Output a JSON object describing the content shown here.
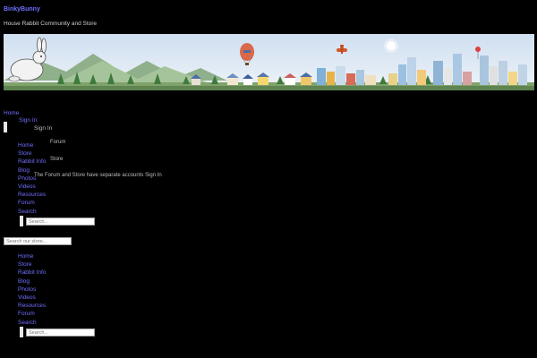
{
  "header": {
    "site_title": "BinkyBunny",
    "tagline": "House Rabbit Community and Store"
  },
  "colors": {
    "background": "#000000",
    "link": "#7070ff",
    "banner_sky": "#dde7f3"
  },
  "nav": {
    "home": "Home",
    "sign_in": "Sign In",
    "sign_in_item": "Sign In"
  },
  "menu_top": {
    "items": [
      "Home",
      "Store",
      "Rabbit Info",
      "Blog",
      "Photos",
      "Videos",
      "Resources",
      "Forum",
      "Search"
    ],
    "forum_note": "Forum",
    "store_note": "Store",
    "message": "The Forum and Store have separate accounts Sign In",
    "search_placeholder": "Search..."
  },
  "store_search": {
    "placeholder": "Search our store..."
  },
  "menu_bottom": {
    "items": [
      "Home",
      "Store",
      "Rabbit Info",
      "Blog",
      "Photos",
      "Videos",
      "Resources",
      "Forum",
      "Search"
    ],
    "search_placeholder": "Search..."
  }
}
